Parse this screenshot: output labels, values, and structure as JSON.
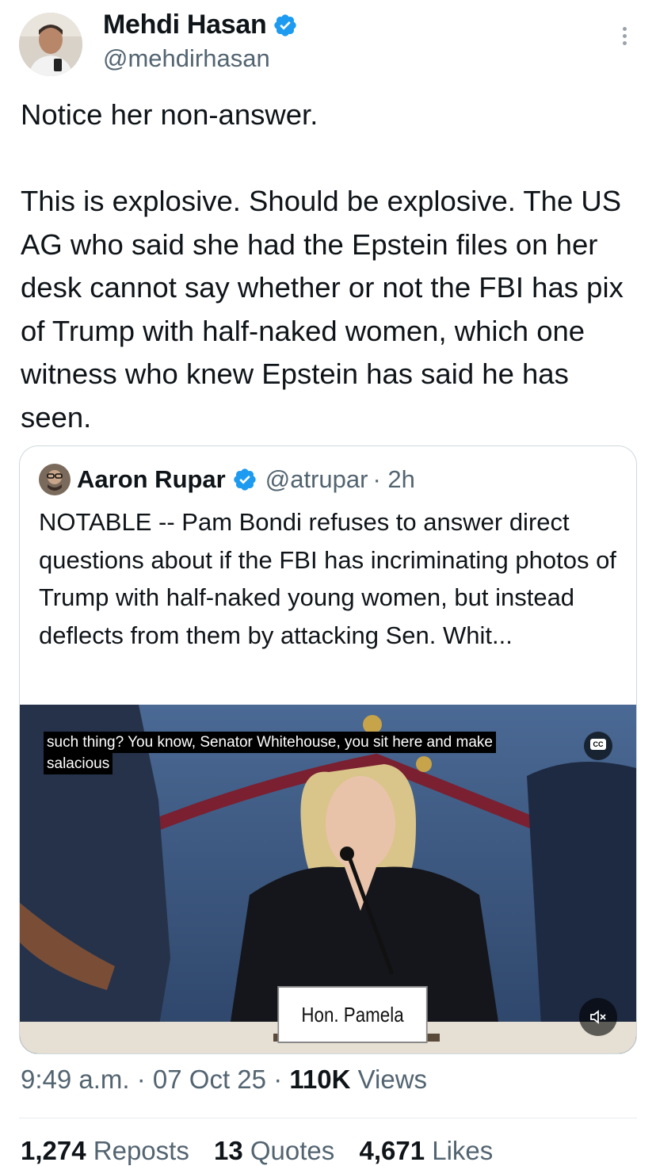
{
  "author": {
    "name": "Mehdi Hasan",
    "handle": "@mehdirhasan"
  },
  "tweet": {
    "text": "Notice her non-answer.\n\nThis is explosive. Should be explosive. The US AG who said she had the Epstein files on her desk cannot say whether or not the FBI has pix of Trump with half-naked women, which one witness who knew Epstein has said he has seen."
  },
  "quote": {
    "name": "Aaron Rupar",
    "handle": "@atrupar",
    "time": "· 2h",
    "text": "NOTABLE -- Pam Bondi refuses to answer direct questions about if the FBI has incriminating photos of Trump with half-naked young women, but instead deflects from them by attacking Sen. Whit...",
    "video": {
      "caption_line1": "such thing? You know, Senator Whitehouse, you sit here and make",
      "caption_line2": "salacious",
      "cc_label": "CC",
      "nameplate": "Hon. Pamela Bondi"
    }
  },
  "meta": {
    "time": "9:49 a.m.",
    "date": "07 Oct 25",
    "views_count": "110K",
    "views_label": "Views"
  },
  "stats": {
    "reposts_count": "1,274",
    "reposts_label": "Reposts",
    "quotes_count": "13",
    "quotes_label": "Quotes",
    "likes_count": "4,671",
    "likes_label": "Likes"
  },
  "colors": {
    "text": "#0f1419",
    "secondary": "#536471",
    "verified": "#1d9bf0",
    "border": "#cfd9de"
  }
}
